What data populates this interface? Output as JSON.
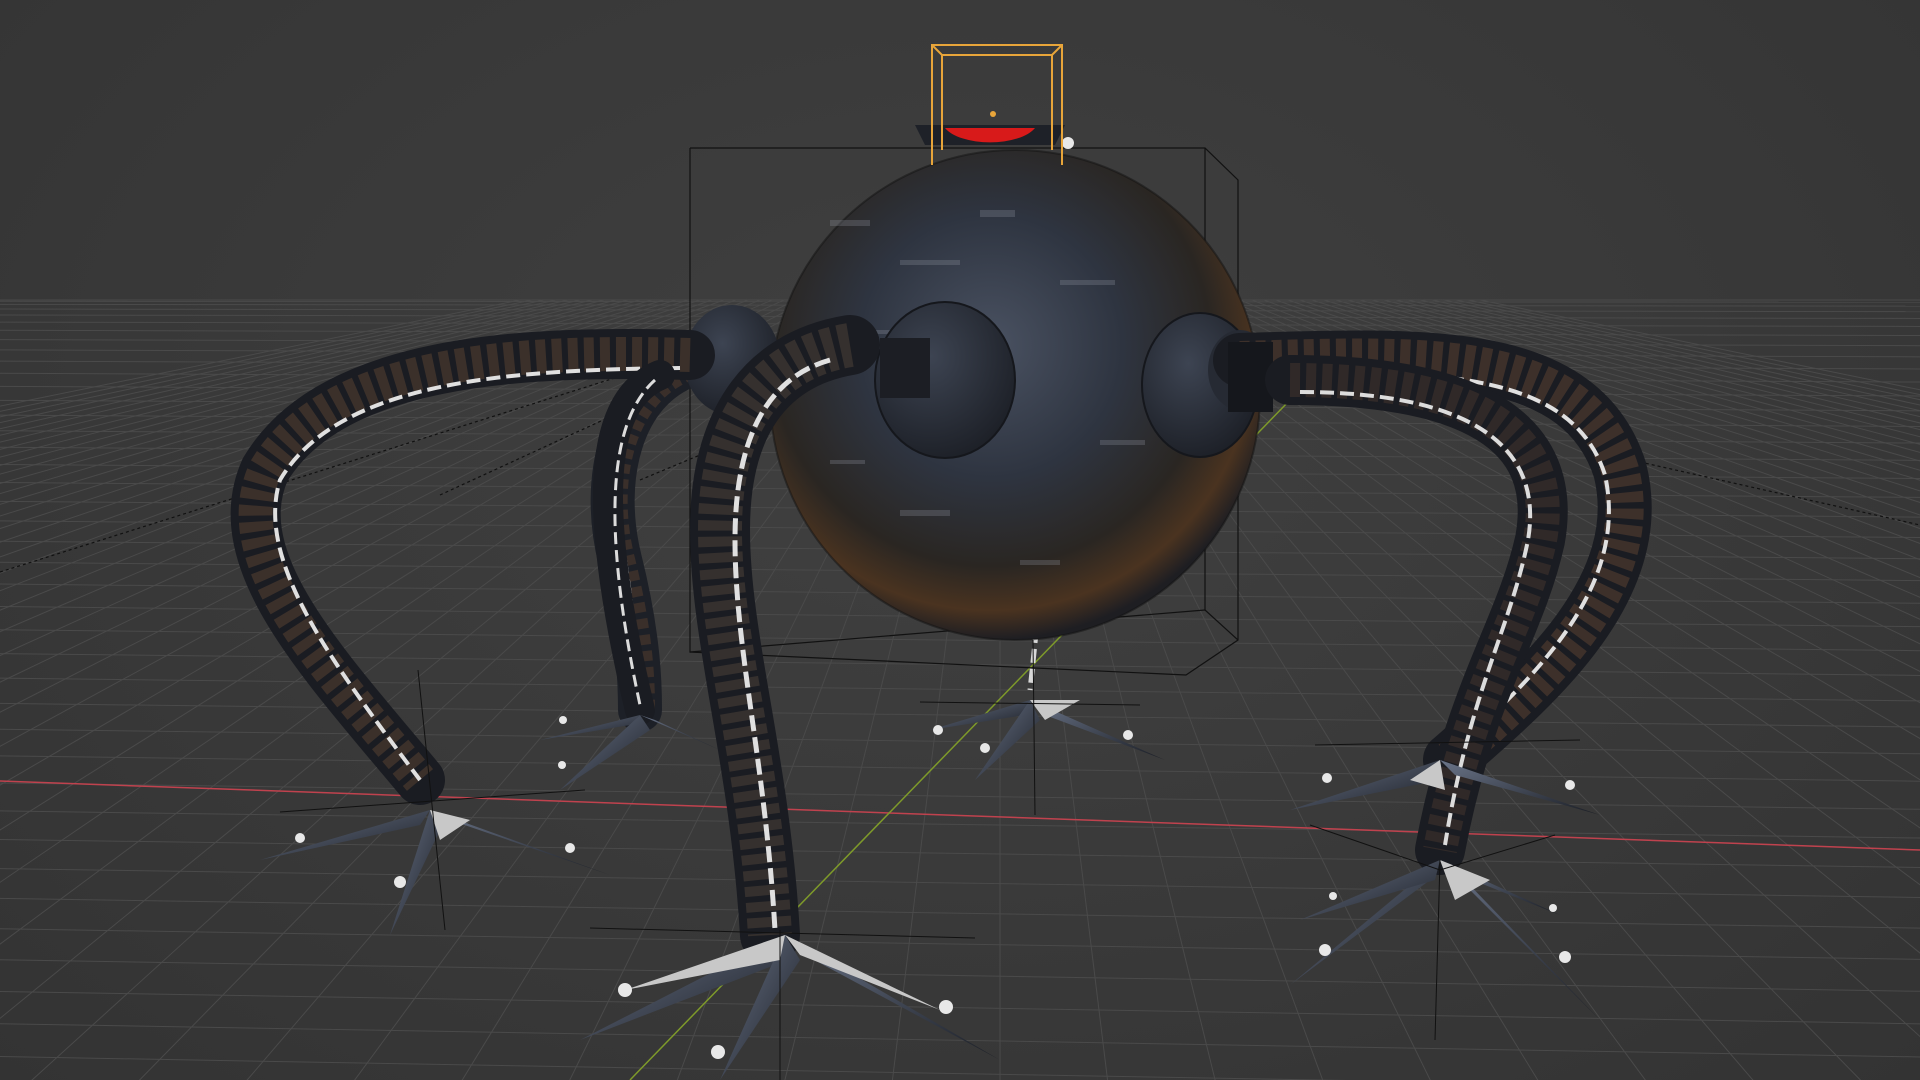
{
  "viewport": {
    "background_color": "#3a3a3a",
    "grid_color": "#4a4a4a",
    "x_axis_color": "#c0424e",
    "y_axis_color": "#7e9a2a",
    "selection_color": "#e8a53a"
  },
  "scene": {
    "object": "spider-robot",
    "legs": [
      {
        "id": "leg-back-left"
      },
      {
        "id": "leg-front-left"
      },
      {
        "id": "leg-center"
      },
      {
        "id": "leg-back-right"
      },
      {
        "id": "leg-front-right"
      },
      {
        "id": "leg-far-right"
      }
    ],
    "head_status_light_color": "#d81a1a"
  }
}
